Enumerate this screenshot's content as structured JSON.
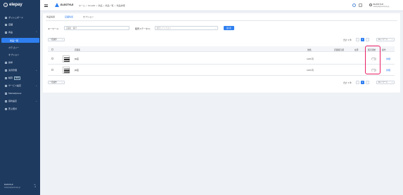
{
  "sidebar": {
    "logo": "elepay",
    "items": [
      {
        "label": "ダッシュボード"
      },
      {
        "label": "店舗"
      },
      {
        "label": "商品"
      },
      {
        "label": "請求"
      },
      {
        "label": "決済管理"
      },
      {
        "label": "精算",
        "badge": "NEW"
      },
      {
        "label": "サービス設定"
      },
      {
        "label": "Marketplace"
      },
      {
        "label": "契約設定"
      },
      {
        "label": "売上統計"
      }
    ],
    "sub_items": [
      {
        "label": "商品一覧"
      },
      {
        "label": "カテゴリー"
      },
      {
        "label": "オプション"
      }
    ],
    "footer": {
      "name": "ELESTYLE",
      "mail": "elestyle@example.jp"
    }
  },
  "header": {
    "brand": "ELESTYLE",
    "breadcrumbs": [
      "ホーム",
      "/",
      "OneQR",
      "/",
      "商品",
      "/",
      "商品一覧",
      "/",
      "商品詳細"
    ],
    "user": {
      "name": "ELESTYLE",
      "mail": "elestyle@example.jp"
    }
  },
  "tabs": [
    "商品情報",
    "店舗情報",
    "オプション"
  ],
  "search": {
    "keyword_label": "キーワード：",
    "keyword_placeholder": "店舗名・番号",
    "status_label": "販売ステータス：",
    "status_placeholder": "選択してください",
    "button": "検 索"
  },
  "bulk_action": "一括操作",
  "count_text": "合計 2 件",
  "pagination": {
    "prev": "‹",
    "current": "1",
    "next": "›",
    "per_page": "10 / ページ"
  },
  "table": {
    "headers": {
      "name": "店舗名",
      "price": "価格",
      "period": "店舗販売期",
      "stock": "在庫",
      "sale": "販売開始",
      "action": "操作"
    },
    "rows": [
      {
        "name": "JR店",
        "price": "120 円",
        "action": "詳細"
      },
      {
        "name": "JR店",
        "price": "120 円",
        "action": "詳細"
      }
    ]
  },
  "colors": {
    "accent": "#2f7ff0",
    "sidebar": "#1e3a5f",
    "highlight": "#e91e63"
  }
}
